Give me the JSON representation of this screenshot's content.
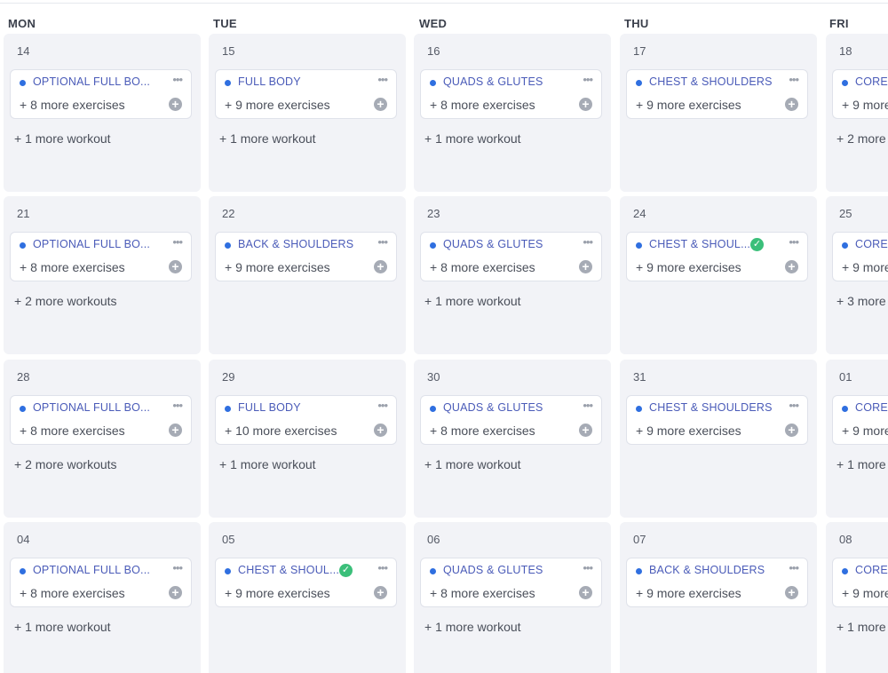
{
  "days": [
    "MON",
    "TUE",
    "WED",
    "THU",
    "FRI"
  ],
  "weeks": [
    [
      {
        "date": "14",
        "title": "OPTIONAL FULL BO...",
        "exercises": "+ 8 more exercises",
        "more": "+ 1 more workout",
        "done": false
      },
      {
        "date": "15",
        "title": "FULL BODY",
        "exercises": "+ 9 more exercises",
        "more": "+ 1 more workout",
        "done": false
      },
      {
        "date": "16",
        "title": "QUADS & GLUTES",
        "exercises": "+ 8 more exercises",
        "more": "+ 1 more workout",
        "done": false
      },
      {
        "date": "17",
        "title": "CHEST & SHOULDERS",
        "exercises": "+ 9 more exercises",
        "more": "",
        "done": false
      },
      {
        "date": "18",
        "title": "CORE",
        "exercises": "+ 9 more",
        "more": "+ 2 more",
        "done": false
      }
    ],
    [
      {
        "date": "21",
        "title": "OPTIONAL FULL BO...",
        "exercises": "+ 8 more exercises",
        "more": "+ 2 more workouts",
        "done": false
      },
      {
        "date": "22",
        "title": "BACK & SHOULDERS",
        "exercises": "+ 9 more exercises",
        "more": "",
        "done": false
      },
      {
        "date": "23",
        "title": "QUADS & GLUTES",
        "exercises": "+ 8 more exercises",
        "more": "+ 1 more workout",
        "done": false
      },
      {
        "date": "24",
        "title": "CHEST & SHOUL...",
        "exercises": "+ 9 more exercises",
        "more": "",
        "done": true
      },
      {
        "date": "25",
        "title": "CORE",
        "exercises": "+ 9 more",
        "more": "+ 3 more",
        "done": false
      }
    ],
    [
      {
        "date": "28",
        "title": "OPTIONAL FULL BO...",
        "exercises": "+ 8 more exercises",
        "more": "+ 2 more workouts",
        "done": false
      },
      {
        "date": "29",
        "title": "FULL BODY",
        "exercises": "+ 10 more exercises",
        "more": "+ 1 more workout",
        "done": false
      },
      {
        "date": "30",
        "title": "QUADS & GLUTES",
        "exercises": "+ 8 more exercises",
        "more": "+ 1 more workout",
        "done": false
      },
      {
        "date": "31",
        "title": "CHEST & SHOULDERS",
        "exercises": "+ 9 more exercises",
        "more": "",
        "done": false
      },
      {
        "date": "01",
        "title": "CORE &",
        "exercises": "+ 9 more",
        "more": "+ 1 more",
        "done": false
      }
    ],
    [
      {
        "date": "04",
        "title": "OPTIONAL FULL BO...",
        "exercises": "+ 8 more exercises",
        "more": "+ 1 more workout",
        "done": false
      },
      {
        "date": "05",
        "title": "CHEST & SHOUL...",
        "exercises": "+ 9 more exercises",
        "more": "",
        "done": true
      },
      {
        "date": "06",
        "title": "QUADS & GLUTES",
        "exercises": "+ 8 more exercises",
        "more": "+ 1 more workout",
        "done": false
      },
      {
        "date": "07",
        "title": "BACK & SHOULDERS",
        "exercises": "+ 9 more exercises",
        "more": "",
        "done": false
      },
      {
        "date": "08",
        "title": "CORE &",
        "exercises": "+ 9 more",
        "more": "+ 1 more",
        "done": false
      }
    ]
  ],
  "icons": {
    "menu": "more-horizontal-icon",
    "add": "plus-circle-icon",
    "done": "check-circle-icon"
  },
  "colors": {
    "accent": "#2f6fe0",
    "title": "#4a5bb8",
    "done": "#3bbf7a",
    "cell": "#f2f3f7"
  }
}
